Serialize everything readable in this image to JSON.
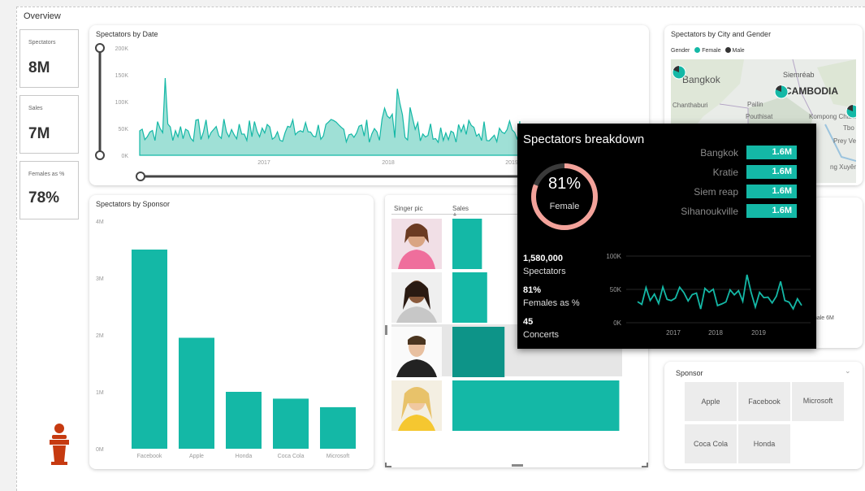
{
  "page": {
    "tab_label": "Overview"
  },
  "kpis": [
    {
      "label": "Spectators",
      "value": "8M"
    },
    {
      "label": "Sales",
      "value": "7M"
    },
    {
      "label": "Females as %",
      "value": "78%"
    }
  ],
  "spectators_by_date": {
    "title": "Spectators by Date",
    "y_ticks": [
      "200K",
      "150K",
      "100K",
      "50K",
      "0K"
    ],
    "x_ticks": [
      "2017",
      "2018",
      "2019"
    ]
  },
  "map": {
    "title": "Spectators by City and Gender",
    "legend_title": "Gender",
    "legend": [
      {
        "name": "Female",
        "color": "#14b8a6"
      },
      {
        "name": "Male",
        "color": "#333333"
      }
    ],
    "labels": {
      "bangkok": "Bangkok",
      "siemreab": "Siemréab",
      "cambodia": "CAMBODIA",
      "chanthaburi": "Chanthaburi",
      "pailin": "Pailin",
      "pouthisat": "Pouthisat",
      "kompong": "Kompong Cham",
      "tbo": "Tbo",
      "prey": "Prey Ve",
      "svay": "ng Xuyên"
    }
  },
  "by_sponsor": {
    "title": "Spectators by Sponsor",
    "y_ticks": [
      "4M",
      "3M",
      "2M",
      "1M",
      "0M"
    ]
  },
  "chart_data": {
    "type": "bar",
    "title": "Spectators by Sponsor",
    "categories": [
      "Facebook",
      "Apple",
      "Honda",
      "Coca Cola",
      "Microsoft"
    ],
    "values": [
      3.5,
      1.95,
      1.0,
      0.88,
      0.73
    ],
    "ylim": [
      0,
      4
    ],
    "y_unit": "M",
    "grid": false
  },
  "singer_table": {
    "col_pic": "Singer pic",
    "col_sales": "Sales",
    "sales_fraction": [
      0.17,
      0.2,
      0.3,
      0.96
    ]
  },
  "tooltip": {
    "title": "Spectators breakdown",
    "donut_value": "81%",
    "donut_label": "Female",
    "donut_fraction": 0.81,
    "cities": [
      {
        "name": "Bangkok",
        "value": "1.6M"
      },
      {
        "name": "Kratie",
        "value": "1.6M"
      },
      {
        "name": "Siem reap",
        "value": "1.6M"
      },
      {
        "name": "Sihanoukville",
        "value": "1.6M"
      }
    ],
    "stats": [
      {
        "value": "1,580,000",
        "label": "Spectators"
      },
      {
        "value": "81%",
        "label": "Females as %"
      },
      {
        "value": "45",
        "label": "Concerts"
      }
    ],
    "mini_y_ticks": [
      "100K",
      "50K",
      "0K"
    ],
    "mini_x_ticks": [
      "2017",
      "2018",
      "2019"
    ]
  },
  "partial_card": {
    "text": "male 6M"
  },
  "sponsor_slicer": {
    "title": "Sponsor",
    "options": [
      "Apple",
      "Facebook",
      "Microsoft",
      "Coca Cola",
      "Honda"
    ]
  },
  "colors": {
    "accent": "#14b8a6",
    "dark_accent": "#0d9488",
    "donut_ring": "#f3a29a",
    "person_icon": "#c63a10"
  }
}
